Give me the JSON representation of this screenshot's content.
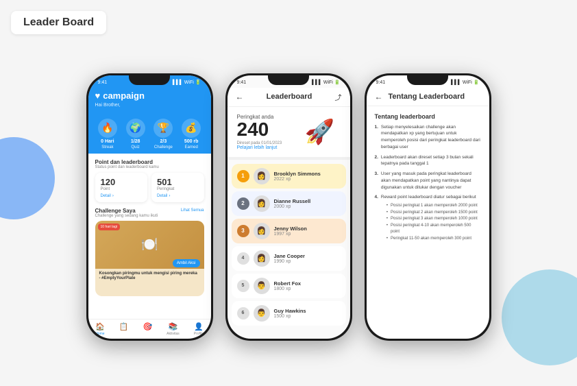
{
  "page": {
    "title": "Leader Board",
    "bg_circle_left_color": "#5b9cf6",
    "bg_circle_right_color": "#7ec8e3"
  },
  "phone1": {
    "status_time": "9:41",
    "header": {
      "title": "campaign",
      "heart": "♥",
      "subtitle": "Hai Brother,"
    },
    "icons": [
      {
        "emoji": "🔥",
        "label": "Streak",
        "value": "0 Hari"
      },
      {
        "emoji": "🌍",
        "label": "Quiz",
        "value": "1/28"
      },
      {
        "emoji": "🏆",
        "label": "Challenge",
        "value": "2/3"
      },
      {
        "emoji": "💰",
        "label": "Earned",
        "value": "500 rb"
      }
    ],
    "point_section": {
      "title": "Point dan leaderboard",
      "subtitle": "Status point dan leaderboard kamu",
      "point_label": "Point",
      "rank_label": "Peringkat",
      "point_val": "120",
      "rank_val": "501",
      "detail": "Detail"
    },
    "challenge": {
      "title": "Challenge Saya",
      "link": "Lihat Semua",
      "subtitle": "Challenge yang sedang kamu ikuti",
      "badge": "10 hari lagi",
      "cta": "Ambil Aksi",
      "desc": "Kosongkan piringmu untuk mengisi piring mereka - #EmptyYourPlate"
    },
    "bottom_nav": [
      {
        "icon": "🏠",
        "label": "Home"
      },
      {
        "icon": "📋",
        "label": ""
      },
      {
        "icon": "🎯",
        "label": ""
      },
      {
        "icon": "📚",
        "label": "Aktivitas"
      },
      {
        "icon": "👤",
        "label": "Profile"
      }
    ]
  },
  "phone2": {
    "status_time": "9:41",
    "header": {
      "back": "←",
      "title": "Leaderboard",
      "share": "⤴"
    },
    "rank_section": {
      "label": "Peringkat anda",
      "value": "240",
      "reset_text": "Direset pada 01/01/2023",
      "link": "Pelajari lebih lanjut",
      "emoji": "🚀"
    },
    "leaderboard": [
      {
        "rank": 1,
        "type": "gold",
        "name": "Brooklyn Simmons",
        "xp": "2022 xp",
        "avatar": "👩"
      },
      {
        "rank": 2,
        "type": "silver",
        "name": "Dianne Russell",
        "xp": "2000 xp",
        "avatar": "👩"
      },
      {
        "rank": 3,
        "type": "bronze",
        "name": "Jenny Wilson",
        "xp": "1997 xp",
        "avatar": "👩"
      },
      {
        "rank": 4,
        "type": "plain",
        "name": "Jane Cooper",
        "xp": "1990 xp",
        "avatar": "👩"
      },
      {
        "rank": 5,
        "type": "plain",
        "name": "Robert Fox",
        "xp": "1800 xp",
        "avatar": "👨"
      },
      {
        "rank": 6,
        "type": "plain",
        "name": "Guy Hawkins",
        "xp": "1500 xp",
        "avatar": "👨"
      }
    ]
  },
  "phone3": {
    "status_time": "9:41",
    "header": {
      "back": "←",
      "title": "Tentang Leaderboard"
    },
    "content": {
      "section_title": "Tentang leaderboard",
      "items": [
        {
          "num": "1.",
          "text": "Setiap menyelesaikan challenge akan mendapatkan xp yang bertujuan untuk memperoleh posisi dari peringkat leaderboard dari berbagai user"
        },
        {
          "num": "2.",
          "text": "Leaderboard akan direset setiap 3 bulan sekali tepatnya pada tanggal 1"
        },
        {
          "num": "3.",
          "text": "User yang masuk pada peringkat leaderboard akan mendapatkan point yang nantinya dapat digunakan untuk ditukar dengan voucher"
        },
        {
          "num": "4.",
          "text": "Reward point leaderboard diatur sebagai berikut",
          "subitems": [
            "Posisi peringkat 1 akan memperoleh 2000 point",
            "Posisi peringkat 2 akan memperoleh 1500 point",
            "Posisi peringkat 3 akan memperoleh 1000 point",
            "Posisi peringkat 4-10 akan memperoleh 500 point",
            "Peringkat 11-50 akan memperoleh 300 point"
          ]
        }
      ]
    }
  }
}
